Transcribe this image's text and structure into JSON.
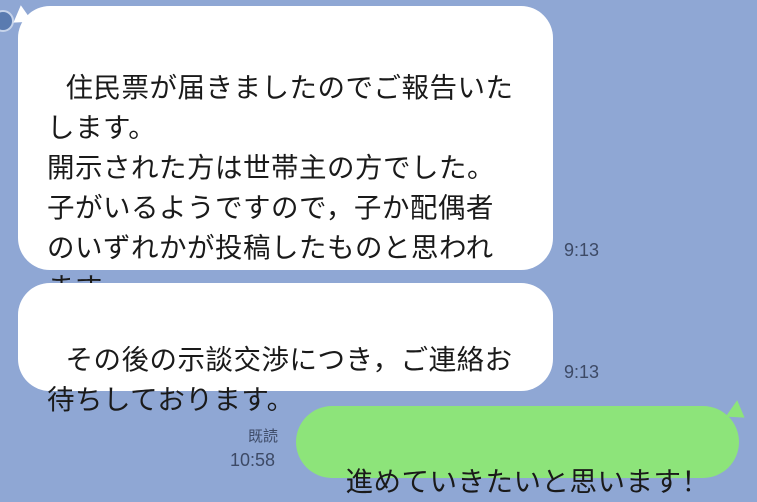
{
  "messages": [
    {
      "direction": "incoming",
      "text": "住民票が届きましたのでご報告いた\nします。\n開示された方は世帯主の方でした。\n子がいるようですので，子か配偶者\nのいずれかが投稿したものと思われ\nます。",
      "time": "9:13"
    },
    {
      "direction": "incoming",
      "text": "その後の示談交渉につき，ご連絡お\n待ちしております。",
      "time": "9:13"
    },
    {
      "direction": "outgoing",
      "text": "進めていきたいと思います！",
      "read": "既読",
      "time": "10:58"
    }
  ],
  "colors": {
    "background": "#8fa7d4",
    "incoming_bubble": "#ffffff",
    "outgoing_bubble": "#8de47a",
    "meta_text": "#3d4a66"
  },
  "icons": {
    "avatar": "avatar-icon"
  }
}
